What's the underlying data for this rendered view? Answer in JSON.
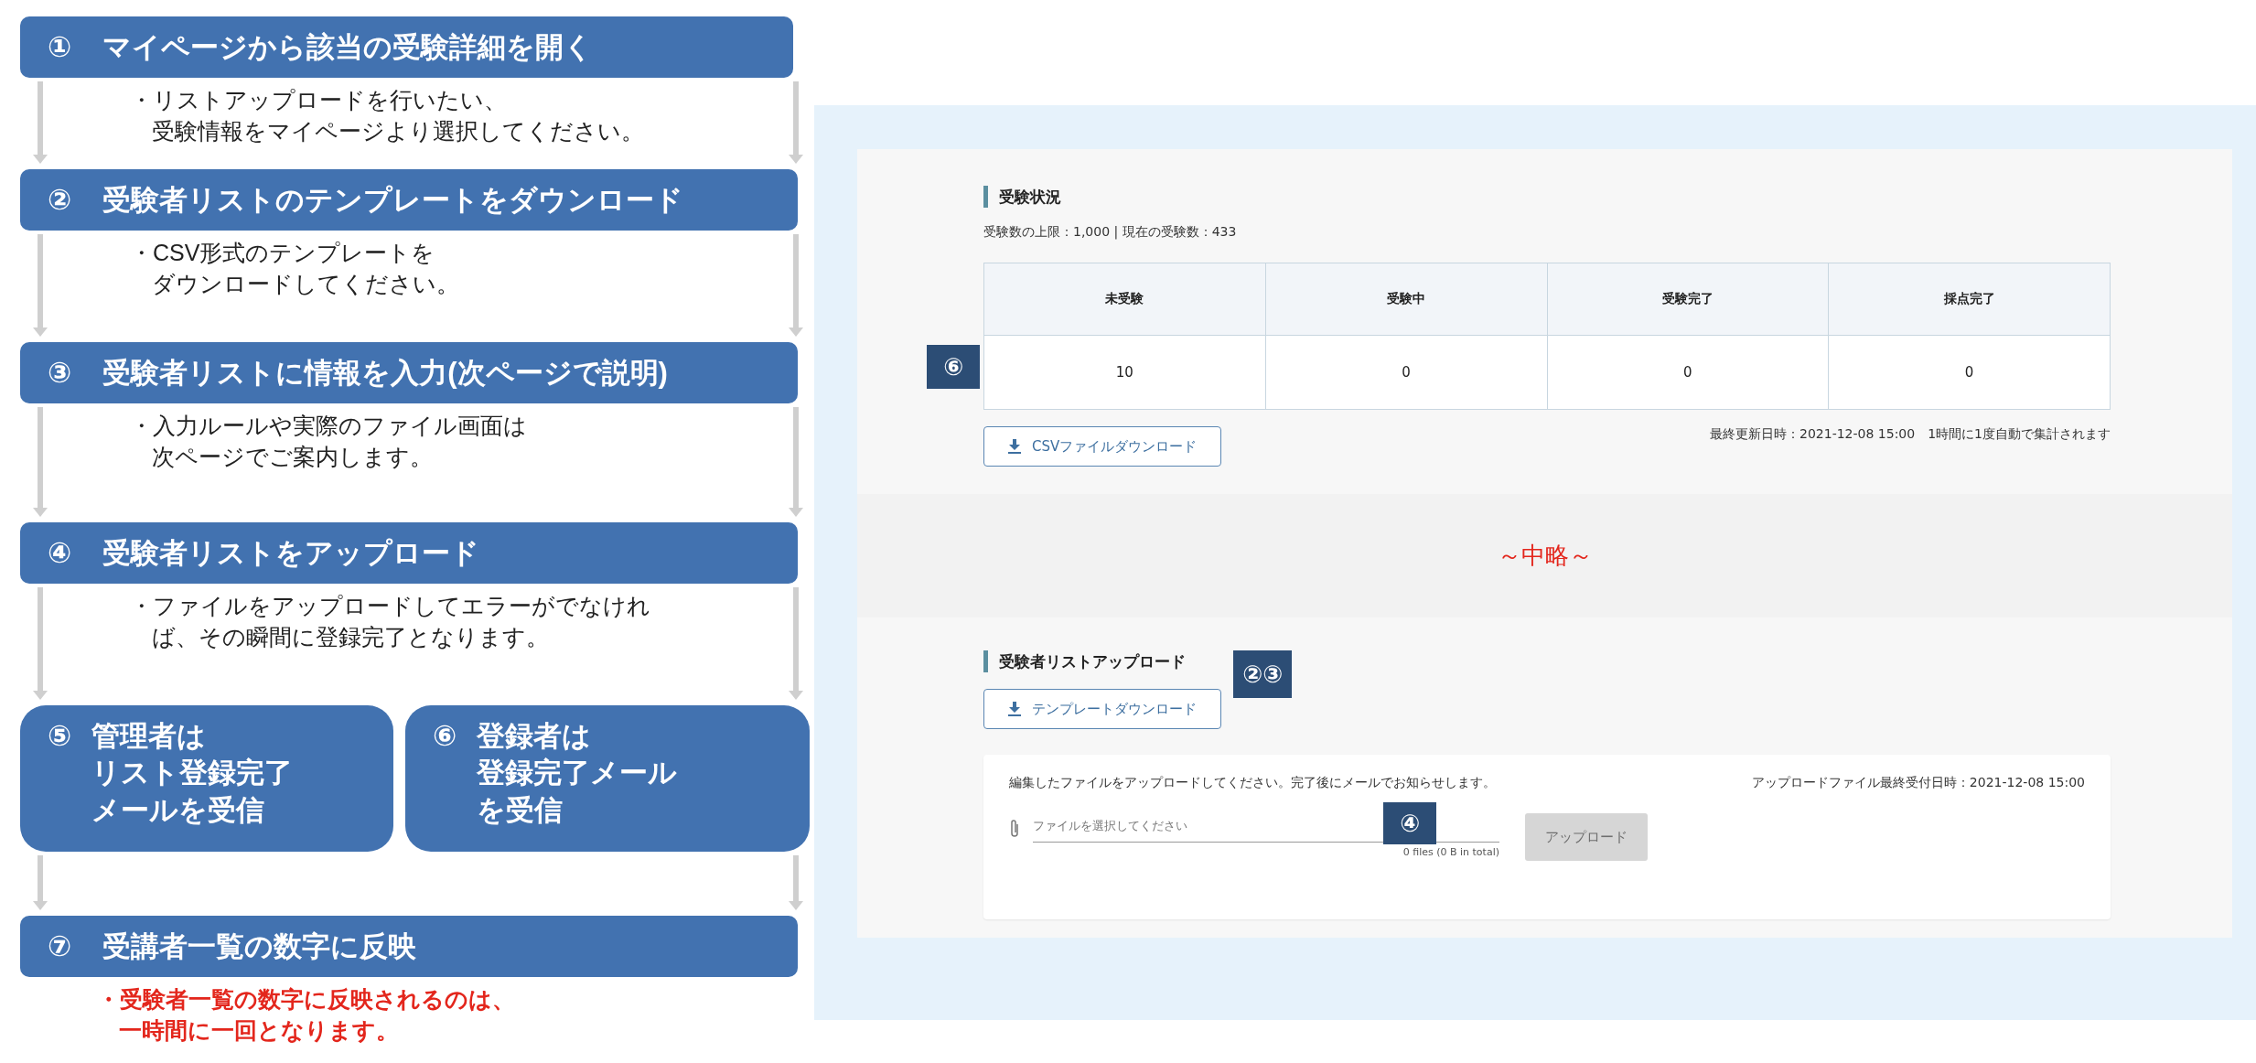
{
  "flow": [
    {
      "kind": "step",
      "number": "①",
      "title": "マイページから該当の受験詳細を開く",
      "note": {
        "kind": "normal",
        "lines": [
          "・リストアップロードを行いたい、",
          "受験情報をマイページより選択してください。"
        ]
      }
    },
    {
      "kind": "step",
      "number": "②",
      "title": "受験者リストのテンプレートをダウンロード",
      "note": {
        "kind": "normal",
        "lines": [
          "・CSV形式のテンプレートを",
          "ダウンロードしてください。"
        ]
      }
    },
    {
      "kind": "step",
      "number": "③",
      "title": "受験者リストに情報を入力(次ページで説明)",
      "note": {
        "kind": "normal",
        "lines": [
          "・入力ルールや実際のファイル画面は",
          "次ページでご案内します。"
        ]
      }
    },
    {
      "kind": "step",
      "number": "④",
      "title": "受験者リストをアップロード",
      "note": {
        "kind": "normal",
        "lines": [
          "・ファイルをアップロードしてエラーがでなけれ",
          "ば、その瞬間に登録完了となります。"
        ]
      }
    },
    {
      "kind": "pair",
      "boxes": [
        {
          "number": "⑤",
          "lines": [
            "管理者は",
            "リスト登録完了",
            "メールを受信"
          ]
        },
        {
          "number": "⑥",
          "lines": [
            "登録者は",
            "登録完了メール",
            "を受信"
          ]
        }
      ]
    },
    {
      "kind": "step",
      "number": "⑦",
      "title": "受講者一覧の数字に反映",
      "note": {
        "kind": "alert",
        "lines": [
          "・受験者一覧の数字に反映されるのは、",
          "一時間に一回となります。"
        ]
      }
    }
  ],
  "screen": {
    "status_section": {
      "title": "受験状況",
      "summary": "受験数の上限：1,000  |  現在の受験数：433",
      "badge": "⑥",
      "table": {
        "columns": [
          "未受験",
          "受験中",
          "受験完了",
          "採点完了"
        ],
        "rows": [
          [
            "10",
            "0",
            "0",
            "0"
          ]
        ]
      },
      "download_button": "CSVファイルダウンロード",
      "updated": "最終更新日時：2021-12-08 15:00　1時間に1度自動で集計されます"
    },
    "omitted": "～中略～",
    "upload_section": {
      "title": "受験者リストアップロード",
      "badge": "②③",
      "template_button": "テンプレートダウンロード",
      "card": {
        "instruction": "編集したファイルをアップロードしてください。完了後にメールでお知らせします。",
        "deadline": "アップロードファイル最終受付日時：2021-12-08 15:00",
        "badge": "④",
        "file_field": {
          "placeholder": "ファイルを選択してください",
          "count": "0 files (0 B in total)"
        },
        "upload_button": {
          "label": "アップロード",
          "disabled": true
        }
      }
    }
  }
}
